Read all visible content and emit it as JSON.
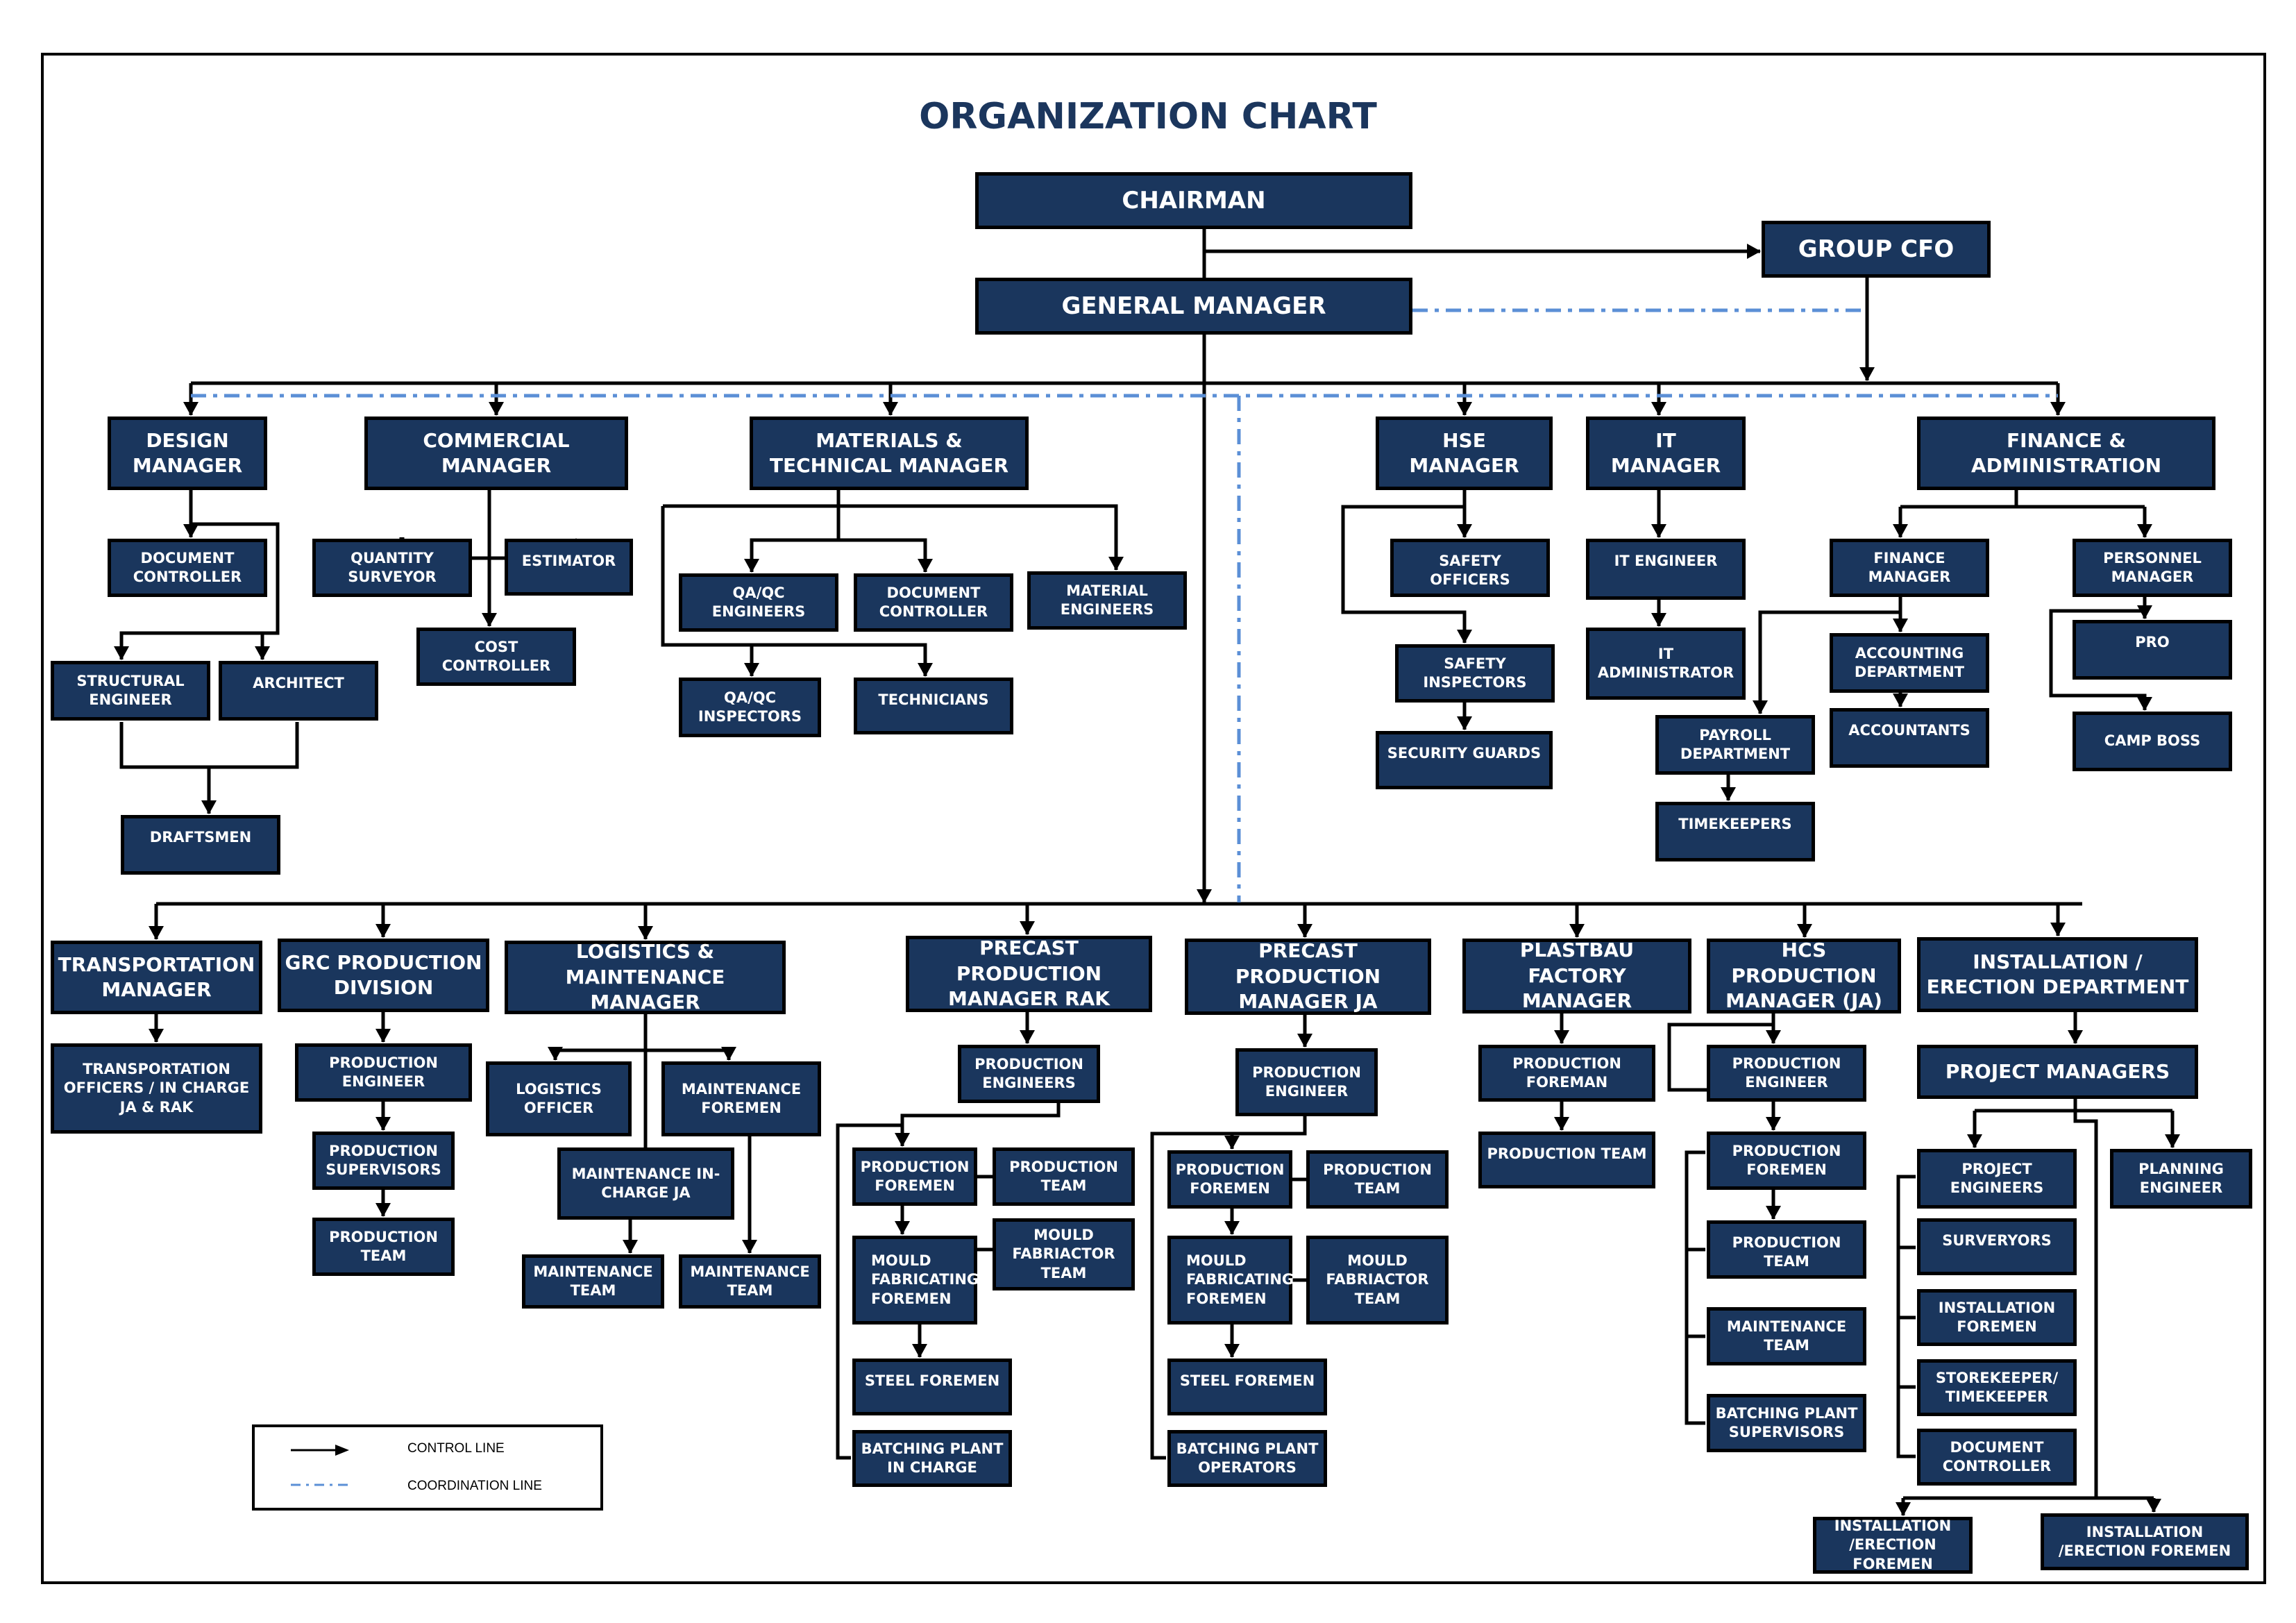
{
  "title": "ORGANIZATION CHART",
  "colors": {
    "box_fill": "#1a365d",
    "title": "#1b365d",
    "coordination_line": "#5b8fd6",
    "control_line": "#000000"
  },
  "legend": {
    "control": "CONTROL LINE",
    "coordination": "COORDINATION LINE"
  },
  "nodes": {
    "chairman": "CHAIRMAN",
    "group_cfo": "GROUP CFO",
    "general_manager": "GENERAL MANAGER",
    "design_manager": "DESIGN\nMANAGER",
    "commercial_manager": "COMMERCIAL\nMANAGER",
    "materials_manager": "MATERIALS &\nTECHNICAL  MANAGER",
    "hse_manager": "HSE\nMANAGER",
    "it_manager": "IT\nMANAGER",
    "finance_admin": "FINANCE &\nADMINISTRATION",
    "design_doc_controller": "DOCUMENT\nCONTROLLER",
    "structural_engineer": "STRUCTURAL\nENGINEER",
    "architect": "ARCHITECT",
    "draftsmen": "DRAFTSMEN",
    "quantity_surveyor": "QUANTITY\nSURVEYOR",
    "estimator": "ESTIMATOR",
    "cost_controller": "COST\nCONTROLLER",
    "qaqc_engineers": "QA/QC\nENGINEERS",
    "mat_doc_controller": "DOCUMENT\nCONTROLLER",
    "material_engineers": "MATERIAL\nENGINEERS",
    "qaqc_inspectors": "QA/QC\nINSPECTORS",
    "technicians": "TECHNICIANS",
    "safety_officers": "SAFETY OFFICERS",
    "safety_inspectors": "SAFETY\nINSPECTORS",
    "security_guards": "SECURITY GUARDS",
    "it_engineer": "IT ENGINEER",
    "it_administrator": "IT\nADMINISTRATOR",
    "payroll_department": "PAYROLL\nDEPARTMENT",
    "timekeepers": "TIMEKEEPERS",
    "finance_manager": "FINANCE\nMANAGER",
    "accounting_department": "ACCOUNTING\nDEPARTMENT",
    "accountants": "ACCOUNTANTS",
    "personnel_manager": "PERSONNEL\nMANAGER",
    "pro": "PRO",
    "camp_boss": "CAMP BOSS",
    "transportation_manager": "TRANSPORTATION\nMANAGER",
    "transportation_officers": "TRANSPORTATION\nOFFICERS / IN CHARGE\nJA & RAK",
    "grc_division": "GRC PRODUCTION\nDIVISION",
    "grc_production_engineer": "PRODUCTION\nENGINEER",
    "grc_production_supervisors": "PRODUCTION\nSUPERVISORS",
    "grc_production_team": "PRODUCTION\nTEAM",
    "logistics_manager": "LOGISTICS &\nMAINTENANCE MANAGER",
    "logistics_officer": "LOGISTICS\nOFFICER",
    "maintenance_foremen": "MAINTENANCE\nFOREMEN",
    "maintenance_incharge_ja": "MAINTENANCE IN-\nCHARGE JA",
    "maintenance_team_1": "MAINTENANCE\nTEAM",
    "maintenance_team_2": "MAINTENANCE\nTEAM",
    "precast_rak": "PRECAST PRODUCTION\nMANAGER RAK",
    "rak_production_engineers": "PRODUCTION\nENGINEERS",
    "rak_production_foremen": "PRODUCTION\nFOREMEN",
    "rak_production_team": "PRODUCTION\nTEAM",
    "rak_mould_fabricating": "MOULD\nFABRICATING\nFOREMEN",
    "rak_mould_team": "MOULD\nFABRIACTOR\nTEAM",
    "rak_steel_foremen": "STEEL FOREMEN",
    "rak_batching": "BATCHING PLANT\nIN CHARGE",
    "precast_ja": "PRECAST PRODUCTION\nMANAGER JA",
    "ja_production_engineer": "PRODUCTION\nENGINEER",
    "ja_production_foremen": "PRODUCTION\nFOREMEN",
    "ja_production_team": "PRODUCTION\nTEAM",
    "ja_mould_fabricating": "MOULD\nFABRICATING\nFOREMEN",
    "ja_mould_team": "MOULD\nFABRIACTOR\nTEAM",
    "ja_steel_foremen": "STEEL FOREMEN",
    "ja_batching": "BATCHING PLANT\nOPERATORS",
    "plastbau_manager": "PLASTBAU FACTORY\nMANAGER",
    "plastbau_foreman": "PRODUCTION\nFOREMAN",
    "plastbau_team": "PRODUCTION TEAM",
    "hcs_manager": "HCS PRODUCTION\nMANAGER (JA)",
    "hcs_engineer": "PRODUCTION\nENGINEER",
    "hcs_foremen": "PRODUCTION\nFOREMEN",
    "hcs_team": "PRODUCTION TEAM",
    "hcs_maintenance": "MAINTENANCE\nTEAM",
    "hcs_batching": "BATCHING PLANT\nSUPERVISORS",
    "installation_department": "INSTALLATION /\nERECTION DEPARTMENT",
    "project_managers": "PROJECT MANAGERS",
    "project_engineers": "PROJECT\nENGINEERS",
    "planning_engineer": "PLANNING\nENGINEER",
    "surveryors": "SURVERYORS",
    "installation_foremen": "INSTALLATION\nFOREMEN",
    "storekeeper": "STOREKEEPER/\nTIMEKEEPER",
    "inst_doc_controller": "DOCUMENT\nCONTROLLER",
    "erection_foremen_1": "INSTALLATION\n/ERECTION FOREMEN",
    "erection_foremen_2": "INSTALLATION\n/ERECTION FOREMEN"
  }
}
